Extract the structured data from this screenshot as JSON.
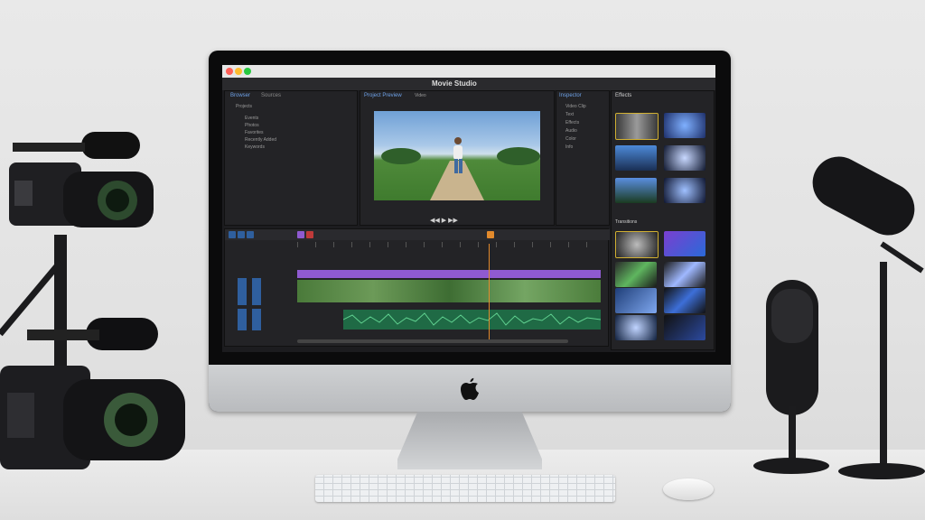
{
  "window": {
    "title": "Movie Studio"
  },
  "browser_panel": {
    "tabs": [
      "Browser",
      "Sources"
    ],
    "items": [
      "Projects",
      "Events",
      "Photos",
      "Favorites",
      "Recently Added",
      "Keywords"
    ]
  },
  "viewer": {
    "tab": "Project Preview",
    "label": "Video"
  },
  "inspector": {
    "tab": "Inspector",
    "items": [
      "Video Clip",
      "Text",
      "Effects",
      "Audio",
      "Color",
      "Info"
    ]
  },
  "effects": {
    "tab": "Effects",
    "section": "Transitions"
  },
  "timeline": {
    "playhead_percent": 0.63
  },
  "colors": {
    "accent_blue": "#2f5f9e",
    "audio_green": "#1f6a45",
    "title_purple": "#8f5ad1",
    "playhead_orange": "#e38a2c"
  }
}
